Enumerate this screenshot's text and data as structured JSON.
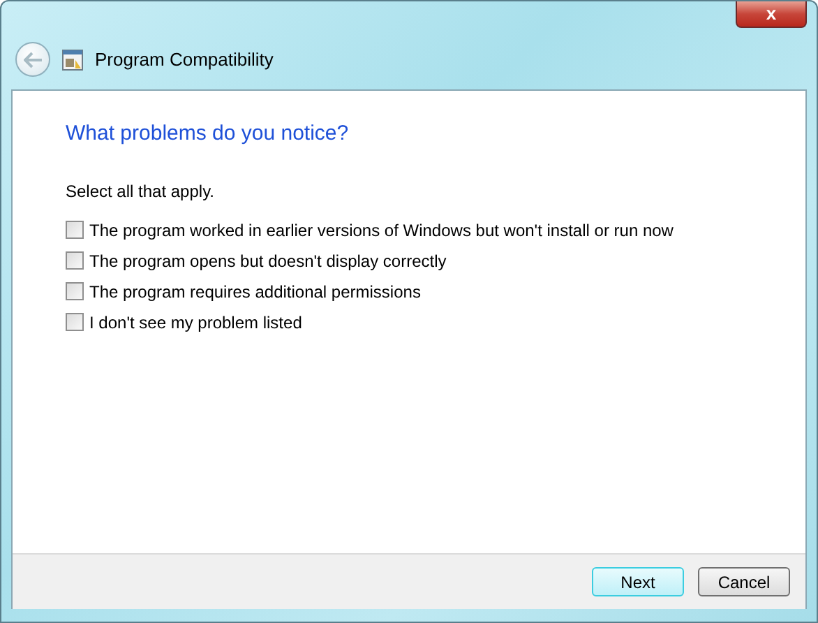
{
  "window": {
    "title": "Program Compatibility",
    "close_label": "x"
  },
  "heading": "What problems do you notice?",
  "instruction": "Select all that apply.",
  "options": [
    {
      "label": "The program worked in earlier versions of Windows but won't install or run now",
      "checked": false
    },
    {
      "label": "The program opens but doesn't display correctly",
      "checked": false
    },
    {
      "label": "The program requires additional permissions",
      "checked": false
    },
    {
      "label": "I don't see my problem listed",
      "checked": false
    }
  ],
  "buttons": [
    {
      "label": "Next",
      "default": true
    },
    {
      "label": "Cancel",
      "default": false
    }
  ]
}
